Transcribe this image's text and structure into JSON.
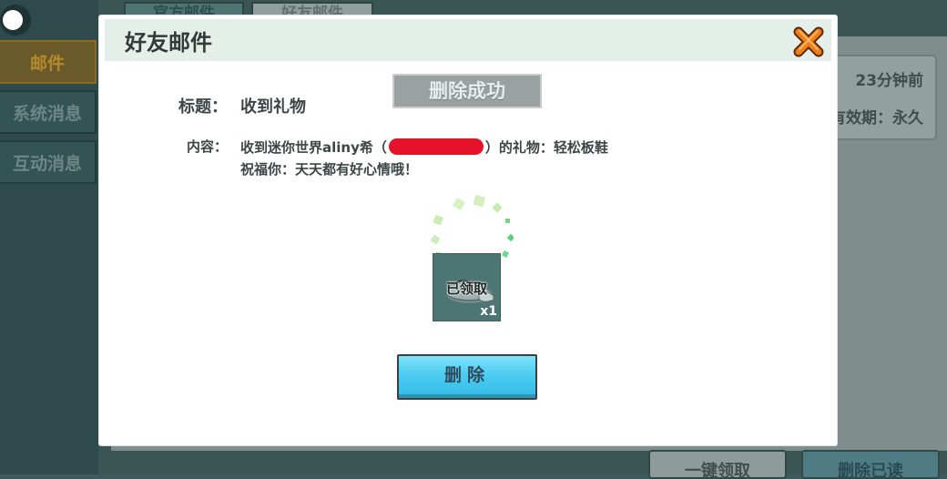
{
  "sidebar": {
    "tabs": [
      {
        "label": "邮件"
      },
      {
        "label": "系统消息"
      },
      {
        "label": "互动消息"
      }
    ]
  },
  "top_tabs": [
    {
      "label": "官方邮件"
    },
    {
      "label": "好友邮件"
    }
  ],
  "mail_card": {
    "time": "23分钟前",
    "validity": "有效期：永久"
  },
  "bottom_buttons": {
    "claim_all": "一键领取",
    "delete_read": "删除已读"
  },
  "modal": {
    "title": "好友邮件",
    "toast": "删除成功",
    "subject_label": "标题：",
    "subject_value": "收到礼物",
    "content_label": "内容：",
    "content_prefix": "收到迷你世界aliny希（",
    "content_suffix": "）的礼物：轻松板鞋",
    "content_line2": "祝福你：天天都有好心情哦！",
    "gift": {
      "name": "轻松板鞋",
      "status": "已领取",
      "quantity": "x1",
      "icon": "sneaker-icon"
    },
    "delete_label": "删除"
  },
  "colors": {
    "modal_header": "#e5efe9",
    "toast_bg": "#9aa2a1",
    "delete_btn": "#4fcdf2",
    "close_orange": "#f07c1a",
    "redaction": "#e5122a"
  }
}
